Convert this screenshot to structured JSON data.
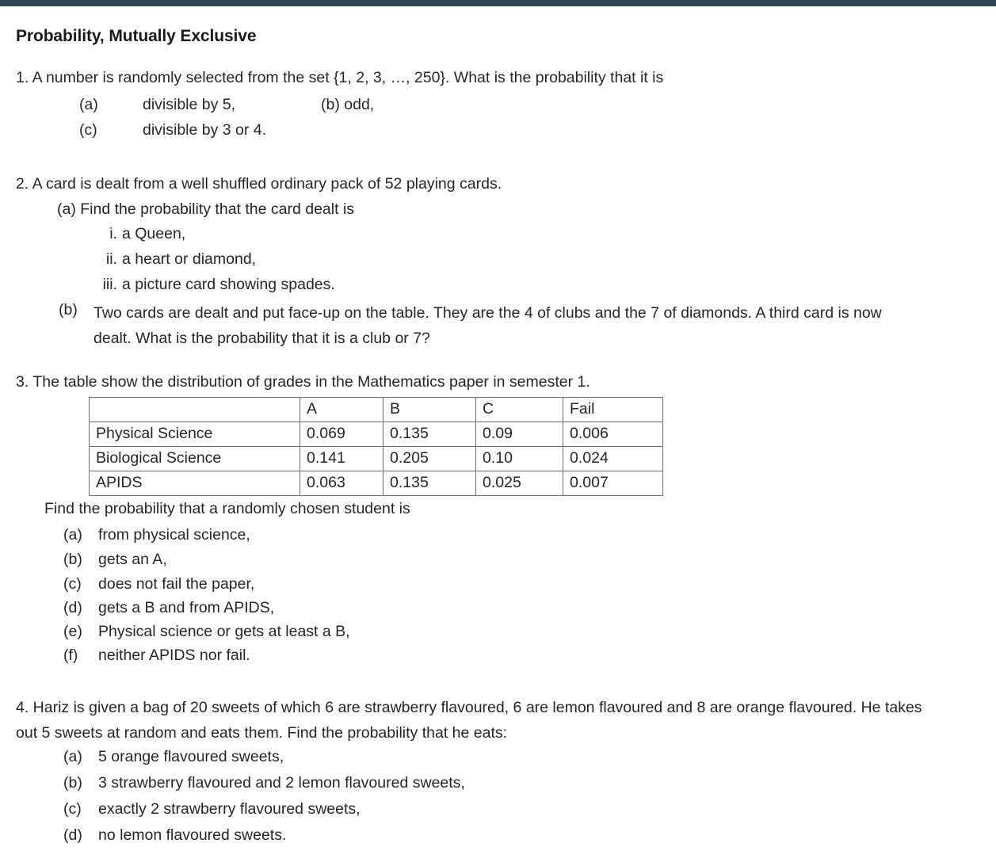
{
  "document": {
    "title": "Probability, Mutually Exclusive",
    "accent_bar_color": "#2e4656",
    "text_color": "#262626",
    "background_color": "#ffffff"
  },
  "questions": {
    "q1": {
      "stem": "1. A number is randomly selected from the set {1, 2, 3, …, 250}. What is the probability that it is",
      "a_label": "(a)",
      "a_text": "divisible by 5,",
      "b_text": "(b) odd,",
      "c_label": "(c)",
      "c_text": "divisible by 3 or 4."
    },
    "q2": {
      "stem": "2. A card is dealt from a well shuffled ordinary pack of 52 playing cards.",
      "part_a": "(a) Find the probability that the card dealt is",
      "roman": [
        {
          "num": "i.",
          "text": "a Queen,"
        },
        {
          "num": "ii.",
          "text": "a heart or diamond,"
        },
        {
          "num": "iii.",
          "text": "a picture card showing spades."
        }
      ],
      "b_label": "(b)",
      "b_text": "Two cards are dealt and put face-up on the table. They are the 4 of clubs and the 7 of diamonds. A third card is now dealt. What is the probability that it is a club or 7?"
    },
    "q3": {
      "stem": "3. The table show the distribution of grades in the Mathematics paper in semester 1.",
      "table": {
        "columns": [
          "",
          "A",
          "B",
          "C",
          "Fail"
        ],
        "rows": [
          {
            "label": "Physical Science",
            "values": [
              "0.069",
              "0.135",
              "0.09",
              "0.006"
            ]
          },
          {
            "label": "Biological Science",
            "values": [
              "0.141",
              "0.205",
              "0.10",
              "0.024"
            ]
          },
          {
            "label": "APIDS",
            "values": [
              "0.063",
              "0.135",
              "0.025",
              "0.007"
            ]
          }
        ]
      },
      "find_line": "Find the probability that a randomly chosen student is",
      "items": [
        {
          "label": "(a)",
          "text": "from physical science,"
        },
        {
          "label": "(b)",
          "text": "gets an A,"
        },
        {
          "label": "(c)",
          "text": "does not fail the paper,"
        },
        {
          "label": "(d)",
          "text": "gets a B and from APIDS,"
        },
        {
          "label": "(e)",
          "text": "Physical science or gets at least a B,"
        },
        {
          "label": "(f)",
          "text": "neither APIDS nor fail."
        }
      ]
    },
    "q4": {
      "stem": "4. Hariz is given a bag of 20 sweets of which 6 are strawberry flavoured, 6 are lemon flavoured and 8 are orange flavoured. He takes out 5 sweets at random and eats them. Find the probability that he eats:",
      "items": [
        {
          "label": "(a)",
          "text": "5 orange flavoured sweets,"
        },
        {
          "label": "(b)",
          "text": "3 strawberry flavoured and 2 lemon flavoured sweets,"
        },
        {
          "label": "(c)",
          "text": "exactly 2 strawberry flavoured sweets,"
        },
        {
          "label": "(d)",
          "text": "no lemon flavoured sweets."
        }
      ]
    }
  }
}
